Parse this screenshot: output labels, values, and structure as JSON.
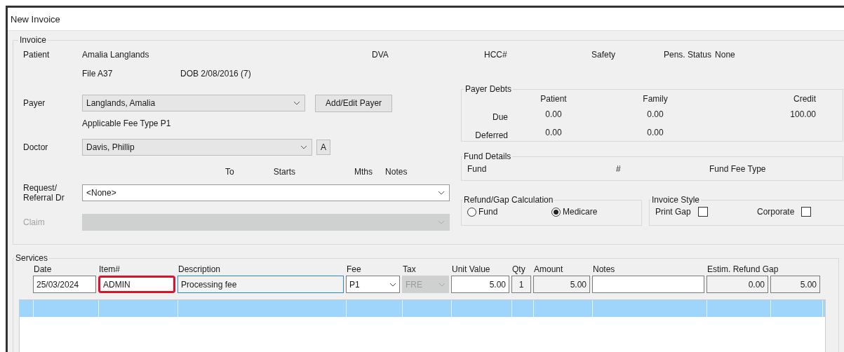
{
  "window": {
    "title": "New Invoice"
  },
  "invoice": {
    "title": "Invoice",
    "patient": {
      "label": "Patient",
      "name": "Amalia Langlands",
      "file": "File A37",
      "dob": "DOB 2/08/2016 (7)"
    },
    "dva": "DVA",
    "hcc": "HCC#",
    "safety": "Safety",
    "pens_status_label": "Pens. Status",
    "pens_status_value": "None",
    "payer": {
      "label": "Payer",
      "value": "Langlands, Amalia",
      "button": "Add/Edit Payer"
    },
    "fee_type": "Applicable Fee Type P1",
    "doctor": {
      "label": "Doctor",
      "value": "Davis, Phillip",
      "button": "A"
    },
    "referral": {
      "label": "Request/ Referral Dr",
      "value": "<None>",
      "headers": [
        "To",
        "Starts",
        "Mths",
        "Notes"
      ]
    },
    "claim": {
      "label": "Claim",
      "disabled": true
    }
  },
  "payer_debts": {
    "title": "Payer Debts",
    "columns": [
      "Patient",
      "Family",
      "Credit"
    ],
    "rows": [
      {
        "label": "Due",
        "values": [
          "0.00",
          "0.00",
          "100.00"
        ]
      },
      {
        "label": "Deferred",
        "values": [
          "0.00",
          "0.00"
        ]
      }
    ]
  },
  "fund_details": {
    "title": "Fund Details",
    "labels": [
      "Fund",
      "#",
      "Fund Fee Type"
    ]
  },
  "refund_gap": {
    "title": "Refund/Gap Calculation",
    "options": [
      {
        "label": "Fund",
        "selected": false
      },
      {
        "label": "Medicare",
        "selected": true
      }
    ]
  },
  "invoice_style": {
    "title": "Invoice Style",
    "options": [
      {
        "label": "Print Gap",
        "checked": false
      },
      {
        "label": "Corporate",
        "checked": false
      }
    ]
  },
  "services": {
    "title": "Services",
    "fields": [
      {
        "header": "Date",
        "kind": "input",
        "value": "25/03/2024",
        "highlighted": false
      },
      {
        "header": "Item#",
        "kind": "input",
        "value": "ADMIN",
        "highlighted": true
      },
      {
        "header": "Description",
        "kind": "focused",
        "value": "Processing fee",
        "highlighted": false
      },
      {
        "header": "Fee",
        "kind": "combo",
        "value": "P1",
        "highlighted": false
      },
      {
        "header": "Tax",
        "kind": "disabled-combo",
        "value": "FRE",
        "highlighted": false
      },
      {
        "header": "Unit Value",
        "kind": "input",
        "value": "5.00",
        "highlighted": false
      },
      {
        "header": "Qty",
        "kind": "readonly",
        "value": "1",
        "highlighted": false
      },
      {
        "header": "Amount",
        "kind": "readonly",
        "value": "5.00",
        "highlighted": false
      },
      {
        "header": "Notes",
        "kind": "input",
        "highlighted": false
      },
      {
        "header": "Estim. Refund Gap",
        "kind": "readonly",
        "value": "0.00",
        "highlighted": false
      },
      {
        "kind": "readonly",
        "value": "5.00",
        "highlighted": false
      }
    ],
    "rows": [
      {
        "selected": true
      }
    ]
  }
}
